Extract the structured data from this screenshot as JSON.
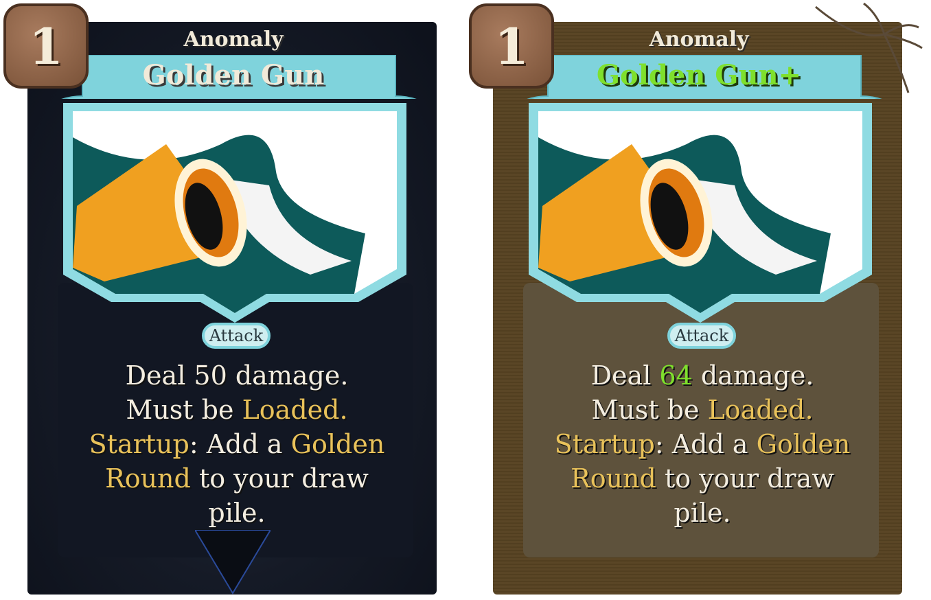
{
  "cards": [
    {
      "cost": "1",
      "type": "Anomaly",
      "title": "Golden Gun",
      "category": "Attack",
      "description": {
        "l1a": "Deal ",
        "damage": "50",
        "l1b": " damage.",
        "l2a": "Must be ",
        "loaded": "Loaded.",
        "startup": "Startup",
        "l3a": ": Add a ",
        "golden": "Golden",
        "round": "Round",
        "l4a": " to your draw",
        "l5": "pile."
      },
      "upgraded": false
    },
    {
      "cost": "1",
      "type": "Anomaly",
      "title": "Golden Gun+",
      "category": "Attack",
      "description": {
        "l1a": "Deal ",
        "damage": "64",
        "l1b": " damage.",
        "l2a": "Must be ",
        "loaded": "Loaded.",
        "startup": "Startup",
        "l3a": ": Add a ",
        "golden": "Golden",
        "round": "Round",
        "l4a": " to your draw",
        "l5": "pile."
      },
      "upgraded": true
    }
  ],
  "colors": {
    "keyword": "#e9c25a",
    "upgrade": "#7fe02c",
    "banner": "#7fd3dc"
  }
}
